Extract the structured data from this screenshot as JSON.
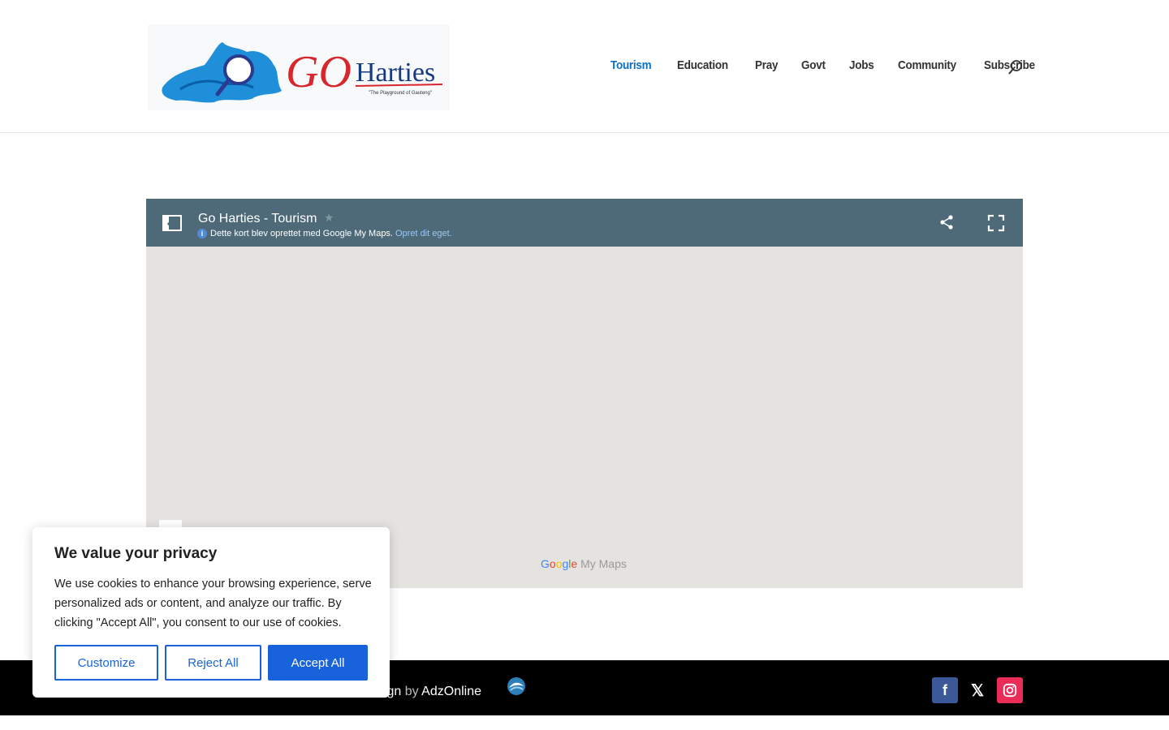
{
  "header": {
    "logo_text_go": "GO",
    "logo_text_harties": "Harties",
    "logo_tagline": "\"The Playground of Gauteng\"",
    "nav": [
      {
        "label": "Tourism",
        "active": true
      },
      {
        "label": "Education",
        "active": false
      },
      {
        "label": "Pray",
        "active": false
      },
      {
        "label": "Govt",
        "active": false
      },
      {
        "label": "Jobs",
        "active": false
      },
      {
        "label": "Community",
        "active": false
      },
      {
        "label": "Subscribe",
        "active": false
      }
    ],
    "search_icon": "search-icon"
  },
  "map": {
    "title": "Go Harties - Tourism",
    "info_text": "Dette kort blev oprettet med Google My Maps.",
    "info_link": "Opret dit eget.",
    "brand_google": [
      "G",
      "o",
      "o",
      "g",
      "l",
      "e"
    ],
    "brand_mymaps": "My Maps",
    "icons": [
      "layers-icon",
      "star-icon",
      "info-icon",
      "share-icon",
      "fullscreen-icon"
    ]
  },
  "footer": {
    "text_partial_1": "esign",
    "text_by": "by",
    "text_brand": "AdzOnline",
    "social": [
      "facebook-icon",
      "x-icon",
      "instagram-icon"
    ],
    "colors": {
      "facebook": "#3b5998",
      "x": "#000000",
      "instagram": "#ea2c59"
    }
  },
  "cookie": {
    "title": "We value your privacy",
    "body": "We use cookies to enhance your browsing experience, serve personalized ads or content, and analyze our traffic. By clicking \"Accept All\", you consent to our use of cookies.",
    "customize": "Customize",
    "reject": "Reject All",
    "accept": "Accept All",
    "accent": "#1863dc"
  },
  "colors": {
    "nav_active": "#0c71c3",
    "map_bar": "#4e6a78",
    "map_bg": "#e5e3df"
  }
}
